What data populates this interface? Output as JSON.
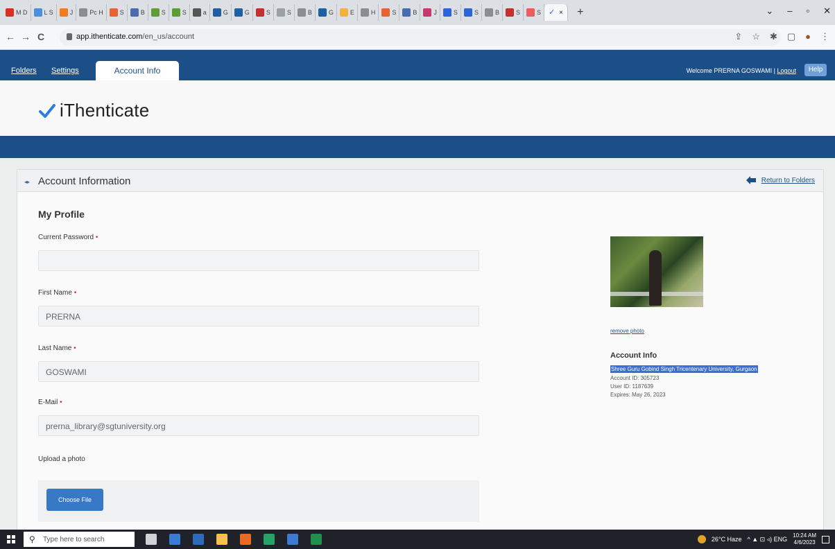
{
  "browser": {
    "tabs": [
      {
        "label": "M D",
        "color": "#d93025"
      },
      {
        "label": "L S",
        "color": "#4a90e2"
      },
      {
        "label": "J",
        "color": "#f27b20"
      },
      {
        "label": "Pc H",
        "color": "#8a8d91"
      },
      {
        "label": "S",
        "color": "#e5642f"
      },
      {
        "label": "B",
        "color": "#4a6db0"
      },
      {
        "label": "S",
        "color": "#5c9e34"
      },
      {
        "label": "S",
        "color": "#5c9e34"
      },
      {
        "label": "a",
        "color": "#555555"
      },
      {
        "label": "G",
        "color": "#1e5fa6"
      },
      {
        "label": "G",
        "color": "#1e5fa6"
      },
      {
        "label": "S",
        "color": "#c4302b"
      },
      {
        "label": "S",
        "color": "#9aa0a6"
      },
      {
        "label": "B",
        "color": "#8a8d91"
      },
      {
        "label": "G",
        "color": "#1e5fa6"
      },
      {
        "label": "E",
        "color": "#f2b33d"
      },
      {
        "label": "H",
        "color": "#8a8d91"
      },
      {
        "label": "S",
        "color": "#e5642f"
      },
      {
        "label": "B",
        "color": "#4a6db0"
      },
      {
        "label": "J",
        "color": "#c23b70"
      },
      {
        "label": "S",
        "color": "#2a66d9"
      },
      {
        "label": "S",
        "color": "#2a66d9"
      },
      {
        "label": "B",
        "color": "#8a8d91"
      },
      {
        "label": "S",
        "color": "#c4302b"
      },
      {
        "label": "S",
        "color": "#e85d5d"
      }
    ],
    "active_tab_color": "#2a66d9",
    "close_glyph": "×",
    "newtab_glyph": "+",
    "window_controls": [
      "⌄",
      "–",
      "▫",
      "✕"
    ],
    "nav": {
      "back": "←",
      "forward": "→",
      "reload": "C"
    },
    "url_host": "app.ithenticate.com",
    "url_path": "/en_us/account",
    "toolbar_icons": [
      "⇪",
      "☆",
      "✱",
      "▢",
      "●",
      "⋮"
    ]
  },
  "site_nav": {
    "links": [
      "Folders",
      "Settings"
    ],
    "active_tab": "Account Info",
    "welcome": "Welcome PRERNA GOSWAMI",
    "separator": "|",
    "logout": "Logout",
    "help": "Help"
  },
  "logo": {
    "name": "iThenticate",
    "check_color": "#2a7de1"
  },
  "panel": {
    "title": "Account Information",
    "return_link": "Return to Folders",
    "section_title": "My Profile",
    "required_marker": "•",
    "fields": [
      {
        "label": "Current Password",
        "value": ""
      },
      {
        "label": "First Name",
        "value": "PRERNA"
      },
      {
        "label": "Last Name",
        "value": "GOSWAMI"
      },
      {
        "label": "E-Mail",
        "value": "prerna_library@sgtuniversity.org"
      }
    ],
    "upload_label": "Upload a photo",
    "choose_file": "Choose File"
  },
  "account_info": {
    "remove_photo": "remove photo",
    "title": "Account Info",
    "institution": "Shree Guru Gobind Singh Tricentenary University, Gurgaon",
    "account_id": "Account ID: 305723",
    "user_id": "User ID: 1187639",
    "expires": "Expires: May 26, 2023"
  },
  "taskbar": {
    "search_placeholder": "Type here to search",
    "search_glyph": "⚲",
    "weather": "26°C Haze",
    "tray_glyphs": "^ ▲ ⊡ ◃) ENG",
    "time": "10:24 AM",
    "date": "4/6/2023",
    "app_colors": [
      "#cfd3d8",
      "#3a7bd5",
      "#2e6bbf",
      "#f7c04a",
      "#ea6a24",
      "#26a269",
      "#3d7ad4",
      "#1f8f4e"
    ]
  }
}
